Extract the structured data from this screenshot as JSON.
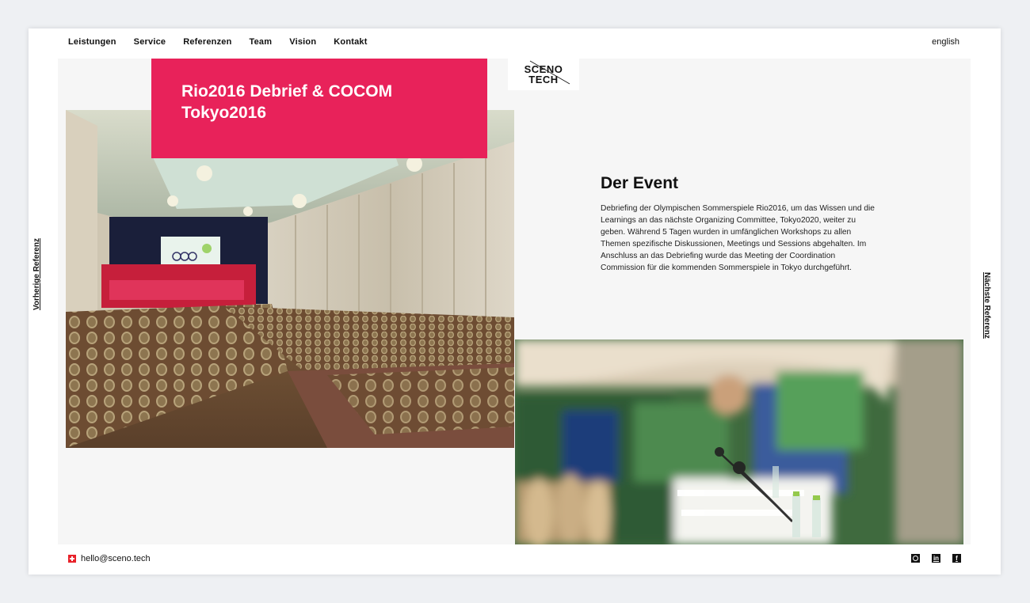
{
  "nav": {
    "items": [
      "Leistungen",
      "Service",
      "Referenzen",
      "Team",
      "Vision",
      "Kontakt"
    ],
    "language": "english"
  },
  "logo": {
    "line1": "SCENO",
    "line2": "TECH"
  },
  "reference": {
    "title": "Rio2016 Debrief & COCOM Tokyo2016"
  },
  "event": {
    "heading": "Der Event",
    "body": "Debriefing der Olympischen Sommerspiele Rio2016, um das Wissen und die Learnings an das nächste Organizing Committee, Tokyo2020, weiter zu geben. Während 5 Tagen wurden in umfänglichen Workshops zu allen Themen spezifische Diskussionen, Meetings und Sessions abgehalten. Im Anschluss an das Debriefing wurde das Meeting der Coordination Commission für die kommenden Sommerspiele in Tokyo durchgeführt."
  },
  "side": {
    "prev": "Vorherige Referenz",
    "next": "Nächste Referenz"
  },
  "footer": {
    "email": "hello@sceno.tech",
    "in_label": "in",
    "fb_label": "f"
  },
  "icons": [
    "swiss-flag-icon",
    "instagram-icon",
    "linkedin-icon",
    "facebook-icon"
  ],
  "colors": {
    "accent": "#e8225a",
    "background": "#f6f6f6"
  }
}
